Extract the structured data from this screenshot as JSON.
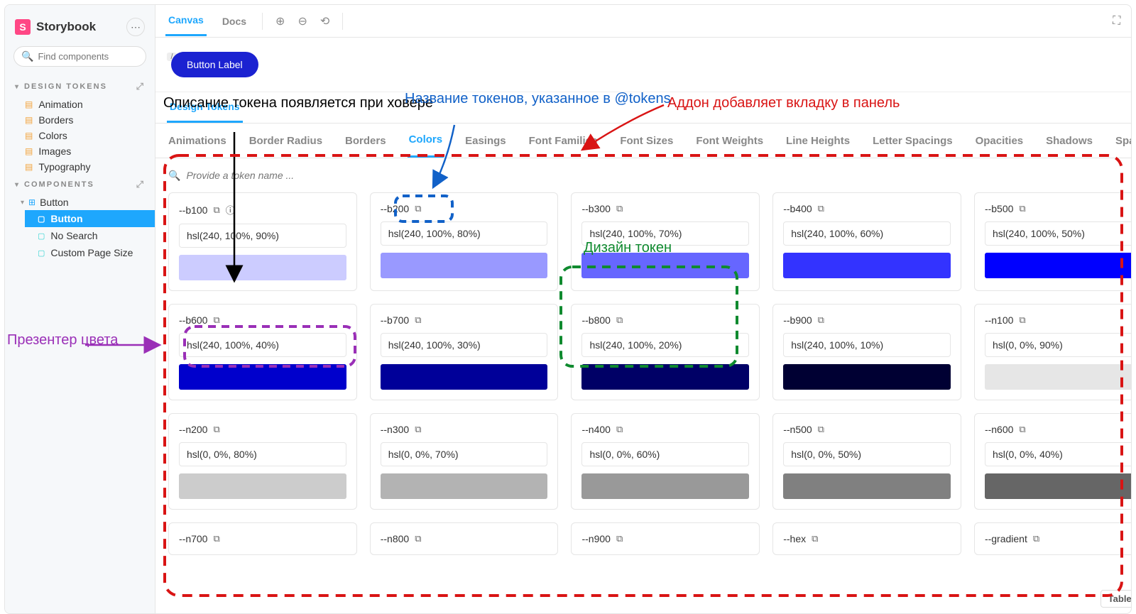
{
  "brand": "Storybook",
  "search": {
    "placeholder": "Find components",
    "shortcut": "/"
  },
  "sidebar": {
    "sections": [
      {
        "title": "DESIGN TOKENS",
        "items": [
          "Animation",
          "Borders",
          "Colors",
          "Images",
          "Typography"
        ]
      },
      {
        "title": "COMPONENTS",
        "items": [
          "Button"
        ],
        "stories": [
          "Button",
          "No Search",
          "Custom Page Size"
        ],
        "active": "Button"
      }
    ]
  },
  "toolbar": {
    "tabs": [
      "Canvas",
      "Docs"
    ],
    "active": "Canvas"
  },
  "canvas": {
    "button_label": "Button Label"
  },
  "panel": {
    "tab": "Design Tokens",
    "categories": [
      "Animations",
      "Border Radius",
      "Borders",
      "Colors",
      "Easings",
      "Font Families",
      "Font Sizes",
      "Font Weights",
      "Line Heights",
      "Letter Spacings",
      "Opacities",
      "Shadows",
      "Spacings"
    ],
    "active_category": "Colors",
    "filter_placeholder": "Provide a token name ...",
    "table_view": "Table View"
  },
  "tokens": [
    {
      "name": "--b100",
      "value": "hsl(240, 100%, 90%)",
      "swatch": "hsl(240,100%,90%)",
      "info": true
    },
    {
      "name": "--b200",
      "value": "hsl(240, 100%, 80%)",
      "swatch": "hsl(240,100%,80%)"
    },
    {
      "name": "--b300",
      "value": "hsl(240, 100%, 70%)",
      "swatch": "hsl(240,100%,70%)"
    },
    {
      "name": "--b400",
      "value": "hsl(240, 100%, 60%)",
      "swatch": "hsl(240,100%,60%)"
    },
    {
      "name": "--b500",
      "value": "hsl(240, 100%, 50%)",
      "swatch": "hsl(240,100%,50%)"
    },
    {
      "name": "--b600",
      "value": "hsl(240, 100%, 40%)",
      "swatch": "hsl(240,100%,40%)"
    },
    {
      "name": "--b700",
      "value": "hsl(240, 100%, 30%)",
      "swatch": "hsl(240,100%,30%)"
    },
    {
      "name": "--b800",
      "value": "hsl(240, 100%, 20%)",
      "swatch": "hsl(240,100%,20%)"
    },
    {
      "name": "--b900",
      "value": "hsl(240, 100%, 10%)",
      "swatch": "hsl(240,100%,10%)"
    },
    {
      "name": "--n100",
      "value": "hsl(0, 0%, 90%)",
      "swatch": "hsl(0,0%,90%)"
    },
    {
      "name": "--n200",
      "value": "hsl(0, 0%, 80%)",
      "swatch": "hsl(0,0%,80%)"
    },
    {
      "name": "--n300",
      "value": "hsl(0, 0%, 70%)",
      "swatch": "hsl(0,0%,70%)"
    },
    {
      "name": "--n400",
      "value": "hsl(0, 0%, 60%)",
      "swatch": "hsl(0,0%,60%)"
    },
    {
      "name": "--n500",
      "value": "hsl(0, 0%, 50%)",
      "swatch": "hsl(0,0%,50%)"
    },
    {
      "name": "--n600",
      "value": "hsl(0, 0%, 40%)",
      "swatch": "hsl(0,0%,40%)"
    },
    {
      "name": "--n700",
      "value": "",
      "swatch": ""
    },
    {
      "name": "--n800",
      "value": "",
      "swatch": ""
    },
    {
      "name": "--n900",
      "value": "",
      "swatch": ""
    },
    {
      "name": "--hex",
      "value": "",
      "swatch": ""
    },
    {
      "name": "--gradient",
      "value": "",
      "swatch": ""
    }
  ],
  "annotations": {
    "hover": "Описание токена появляется при ховере",
    "name": "Название токенов, указанное в @tokens",
    "addon": "Аддон добавляет вкладку в панель",
    "token": "Дизайн токен",
    "presenter": "Презентер цвета"
  }
}
